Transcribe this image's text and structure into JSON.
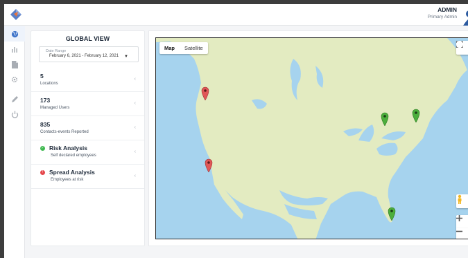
{
  "header": {
    "user_name": "ADMIN",
    "user_role": "Primary Admin"
  },
  "sidebar": {
    "items": [
      {
        "icon": "globe-icon",
        "active": true
      },
      {
        "icon": "bar-chart-icon",
        "active": false
      },
      {
        "icon": "document-icon",
        "active": false
      },
      {
        "icon": "gear-icon",
        "active": false
      },
      {
        "icon": "pencil-icon",
        "active": false
      },
      {
        "icon": "power-icon",
        "active": false
      }
    ]
  },
  "panel": {
    "title": "GLOBAL VIEW",
    "date_label": "Date Range",
    "date_value": "February 6, 2021 - February 12, 2021",
    "stats": [
      {
        "value": "5",
        "label": "Locations"
      },
      {
        "value": "173",
        "label": "Managed Users"
      },
      {
        "value": "835",
        "label": "Contacts-events Reported"
      }
    ],
    "risk": {
      "title": "Risk Analysis",
      "subtitle": "Self declared employees",
      "color": "#3fb950"
    },
    "spread": {
      "title": "Spread Analysis",
      "subtitle": "Employees at risk",
      "color": "#e5484d"
    }
  },
  "map": {
    "tab_map": "Map",
    "tab_satellite": "Satellite",
    "land_color": "#e3ebc1",
    "water_color": "#a6d3ee",
    "markers": [
      {
        "name": "marker-seattle",
        "color": "#e05757",
        "status": "risk"
      },
      {
        "name": "marker-los-angeles",
        "color": "#e05757",
        "status": "risk"
      },
      {
        "name": "marker-toronto",
        "color": "#4cae3c",
        "status": "safe"
      },
      {
        "name": "marker-boston",
        "color": "#4cae3c",
        "status": "safe"
      },
      {
        "name": "marker-miami",
        "color": "#4cae3c",
        "status": "safe"
      }
    ]
  }
}
